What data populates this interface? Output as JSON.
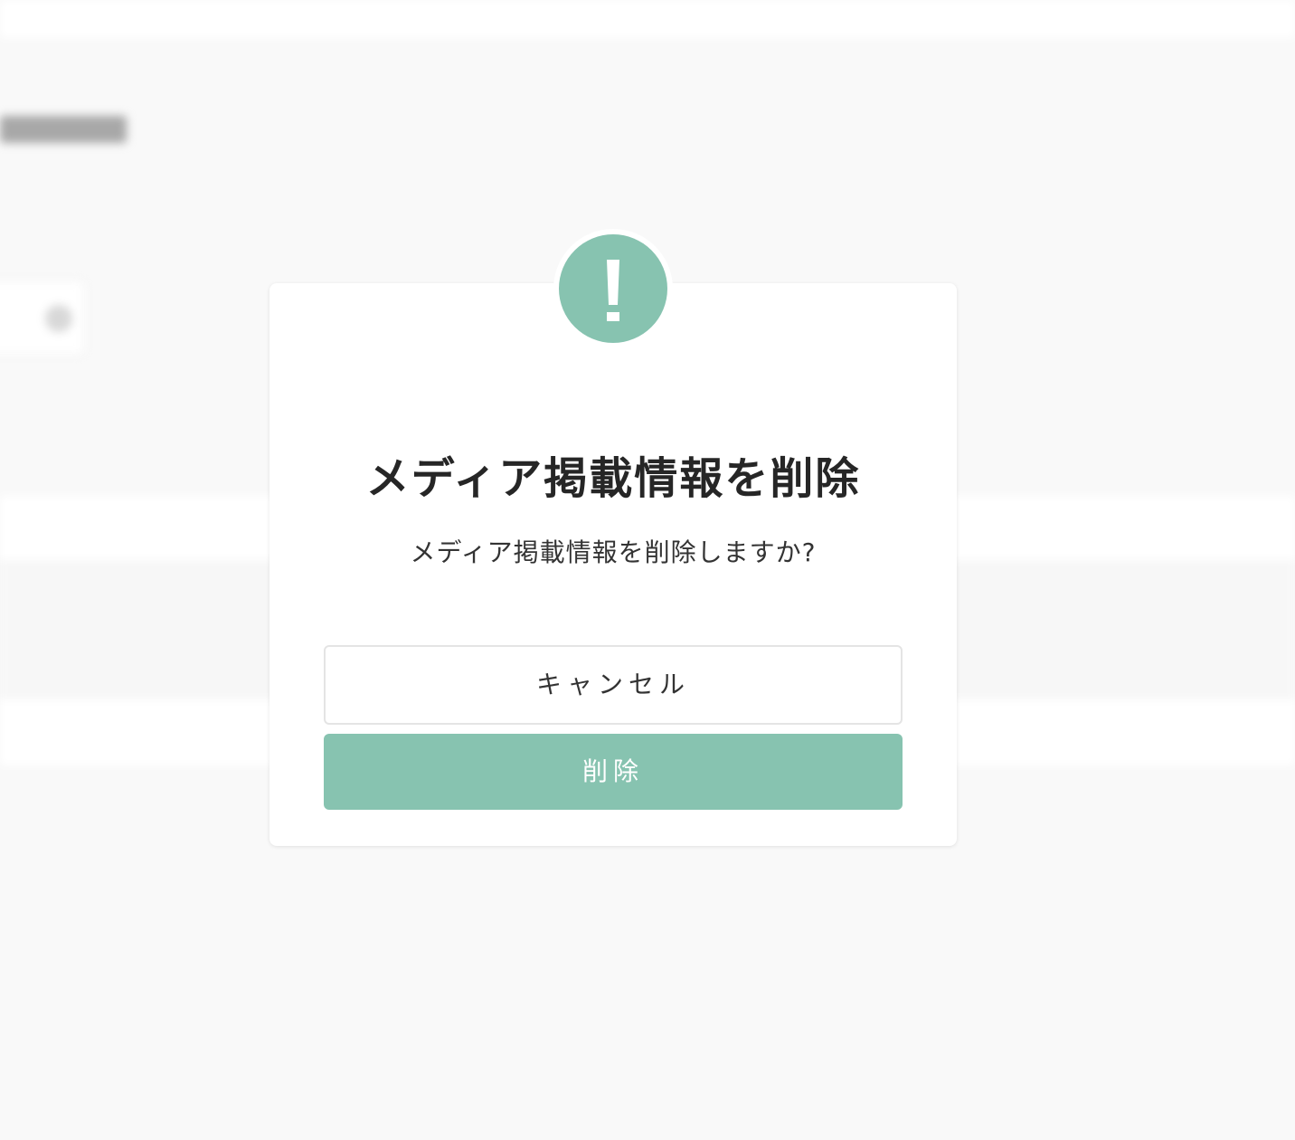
{
  "dialog": {
    "title": "メディア掲載情報を削除",
    "message": "メディア掲載情報を削除しますか?",
    "icon": "exclamation-icon",
    "cancel_label": "キャンセル",
    "delete_label": "削除"
  },
  "colors": {
    "accent": "#87c3b0",
    "text": "#262626",
    "background": "#f9f9f9"
  }
}
